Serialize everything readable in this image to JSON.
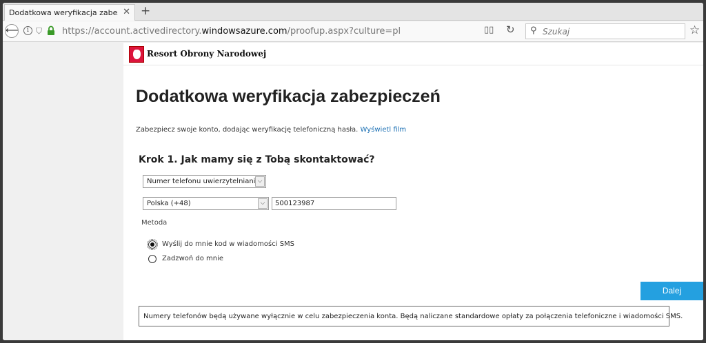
{
  "browser": {
    "tab_title": "Dodatkowa weryfikacja zabezpie",
    "tab_close": "✕",
    "new_tab": "+",
    "url_prefix": "https://account.activedirectory.",
    "url_domain": "windowsazure.com",
    "url_suffix": "/proofup.aspx?culture=pl",
    "search_placeholder": "Szukaj",
    "icons": [
      "back-arrow-icon",
      "info-icon",
      "shield-icon",
      "lock-icon",
      "reader-view-icon",
      "reload-icon",
      "search-icon",
      "bookmark-star-icon"
    ]
  },
  "header": {
    "org_name": "Resort Obrony Narodowej"
  },
  "main": {
    "title": "Dodatkowa weryfikacja zabezpieczeń",
    "subtitle_text": "Zabezpiecz swoje konto, dodając weryfikację telefoniczną hasła. ",
    "subtitle_link": "Wyświetl film",
    "step_title": "Krok 1. Jak mamy się z Tobą skontaktować?",
    "contact_method_selected": "Numer telefonu uwierzytelniania",
    "country_selected": "Polska (+48)",
    "phone_value": "500123987",
    "method_label": "Metoda",
    "options": [
      {
        "label": "Wyślij do mnie kod w wiadomości SMS",
        "selected": true
      },
      {
        "label": "Zadzwoń do mnie",
        "selected": false
      }
    ],
    "next_button": "Dalej",
    "notice": "Numery telefonów będą używane wyłącznie w celu zabezpieczenia konta. Będą naliczane standardowe opłaty za połączenia telefoniczne i wiadomości SMS."
  },
  "colors": {
    "accent": "#24a0e0",
    "link": "#1a6fb3",
    "logo_red": "#dc143c"
  }
}
